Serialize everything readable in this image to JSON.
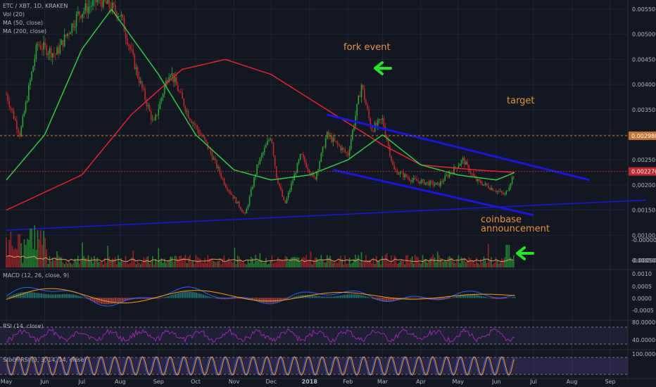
{
  "symbol_title": "ETC / XBT, 1D, KRAKEN",
  "overlays": [
    "Vol (20)",
    "MA (50, close)",
    "MA (200, close)"
  ],
  "colors": {
    "bg": "#131722",
    "grid": "#1f2433",
    "up": "#26a633",
    "down": "#c2282b",
    "ma50": "#2ecc40",
    "ma200": "#e8222e",
    "channel": "#1717e0",
    "annotation": "#e8913a",
    "arrow": "#22e822",
    "axis_text": "#b2b5be",
    "price_badge_target": "#c5752f",
    "price_badge_current": "#c0282d"
  },
  "price_axis_labels": [
    "0.00550",
    "0.00500",
    "0.00450",
    "0.00400",
    "0.00350",
    "0.00300",
    "0.00250",
    "0.00200",
    "0.00150",
    "0.00100",
    "0.00050"
  ],
  "price_badges": {
    "target": "0.002980",
    "current": "0.002270"
  },
  "volume_axis_labels": [
    "-0.00000",
    "-0.00050"
  ],
  "macd": {
    "label": "MACD (12, 26, close, 9)",
    "axis": [
      "0.0010",
      "0.0005",
      "0.0000",
      "-0.0005"
    ]
  },
  "rsi": {
    "label": "RSI (14, close)",
    "axis": [
      "80.0000",
      "40.0000"
    ]
  },
  "stoch": {
    "label": "Stoch RSI (3, 3, 14, 14, close)",
    "axis": [
      "100.0000"
    ]
  },
  "time_axis": [
    "May",
    "Jun",
    "Jul",
    "Aug",
    "Sep",
    "Oct",
    "Nov",
    "Dec",
    "2018",
    "Feb",
    "Mar",
    "Apr",
    "May",
    "Jun",
    "Jul",
    "Aug",
    "Sep"
  ],
  "annotations": {
    "fork": "fork event",
    "target": "target",
    "coinbase_1": "coinbase",
    "coinbase_2": "announcement"
  },
  "chart_data": {
    "type": "candlestick",
    "title": "ETC / XBT, 1D, KRAKEN",
    "ylim": [
      0.0005,
      0.0057
    ],
    "target_level": 0.00298,
    "current_level": 0.00227,
    "price_path": [
      [
        "2017-05-01",
        0.0038
      ],
      [
        "2017-05-12",
        0.003
      ],
      [
        "2017-05-26",
        0.0048
      ],
      [
        "2017-06-10",
        0.0046
      ],
      [
        "2017-06-28",
        0.0054
      ],
      [
        "2017-07-15",
        0.0057
      ],
      [
        "2017-08-01",
        0.0054
      ],
      [
        "2017-08-15",
        0.0042
      ],
      [
        "2017-08-28",
        0.0032
      ],
      [
        "2017-09-10",
        0.0043
      ],
      [
        "2017-09-25",
        0.0034
      ],
      [
        "2017-10-10",
        0.0028
      ],
      [
        "2017-10-25",
        0.002
      ],
      [
        "2017-11-10",
        0.0014
      ],
      [
        "2017-11-20",
        0.0024
      ],
      [
        "2017-12-01",
        0.003
      ],
      [
        "2017-12-05",
        0.0022
      ],
      [
        "2017-12-12",
        0.0016
      ],
      [
        "2017-12-25",
        0.0026
      ],
      [
        "2018-01-05",
        0.0021
      ],
      [
        "2018-01-15",
        0.003
      ],
      [
        "2018-02-01",
        0.0026
      ],
      [
        "2018-02-12",
        0.004
      ],
      [
        "2018-02-20",
        0.0031
      ],
      [
        "2018-03-01",
        0.0033
      ],
      [
        "2018-03-10",
        0.0023
      ],
      [
        "2018-03-25",
        0.0021
      ],
      [
        "2018-04-15",
        0.002
      ],
      [
        "2018-05-05",
        0.0025
      ],
      [
        "2018-05-15",
        0.0021
      ],
      [
        "2018-06-08",
        0.0018
      ],
      [
        "2018-06-16",
        0.00227
      ]
    ],
    "ma50_path": [
      [
        "2017-05-01",
        0.0021
      ],
      [
        "2017-06-01",
        0.003
      ],
      [
        "2017-07-01",
        0.0047
      ],
      [
        "2017-07-25",
        0.0055
      ],
      [
        "2017-09-01",
        0.0042
      ],
      [
        "2017-10-01",
        0.003
      ],
      [
        "2017-11-01",
        0.0023
      ],
      [
        "2017-12-01",
        0.0021
      ],
      [
        "2018-01-01",
        0.0022
      ],
      [
        "2018-02-01",
        0.0025
      ],
      [
        "2018-03-01",
        0.003
      ],
      [
        "2018-04-01",
        0.0024
      ],
      [
        "2018-05-01",
        0.0022
      ],
      [
        "2018-06-01",
        0.0021
      ],
      [
        "2018-06-16",
        0.00225
      ]
    ],
    "ma200_path": [
      [
        "2017-05-01",
        0.0015
      ],
      [
        "2017-07-01",
        0.0022
      ],
      [
        "2017-08-10",
        0.0034
      ],
      [
        "2017-09-20",
        0.0043
      ],
      [
        "2017-10-25",
        0.0045
      ],
      [
        "2017-12-01",
        0.0042
      ],
      [
        "2018-01-15",
        0.0035
      ],
      [
        "2018-03-01",
        0.0028
      ],
      [
        "2018-04-01",
        0.0024
      ],
      [
        "2018-05-15",
        0.0023
      ],
      [
        "2018-06-16",
        0.00225
      ]
    ],
    "trendlines": [
      {
        "name": "support",
        "from": [
          "2017-05-01",
          0.0011
        ],
        "to": [
          "2018-09-30",
          0.0017
        ]
      },
      {
        "name": "channel-upper",
        "from": [
          "2018-01-15",
          0.0034
        ],
        "to": [
          "2018-08-15",
          0.0021
        ]
      },
      {
        "name": "channel-lower",
        "from": [
          "2018-01-20",
          0.0023
        ],
        "to": [
          "2018-07-01",
          0.0014
        ]
      }
    ]
  }
}
